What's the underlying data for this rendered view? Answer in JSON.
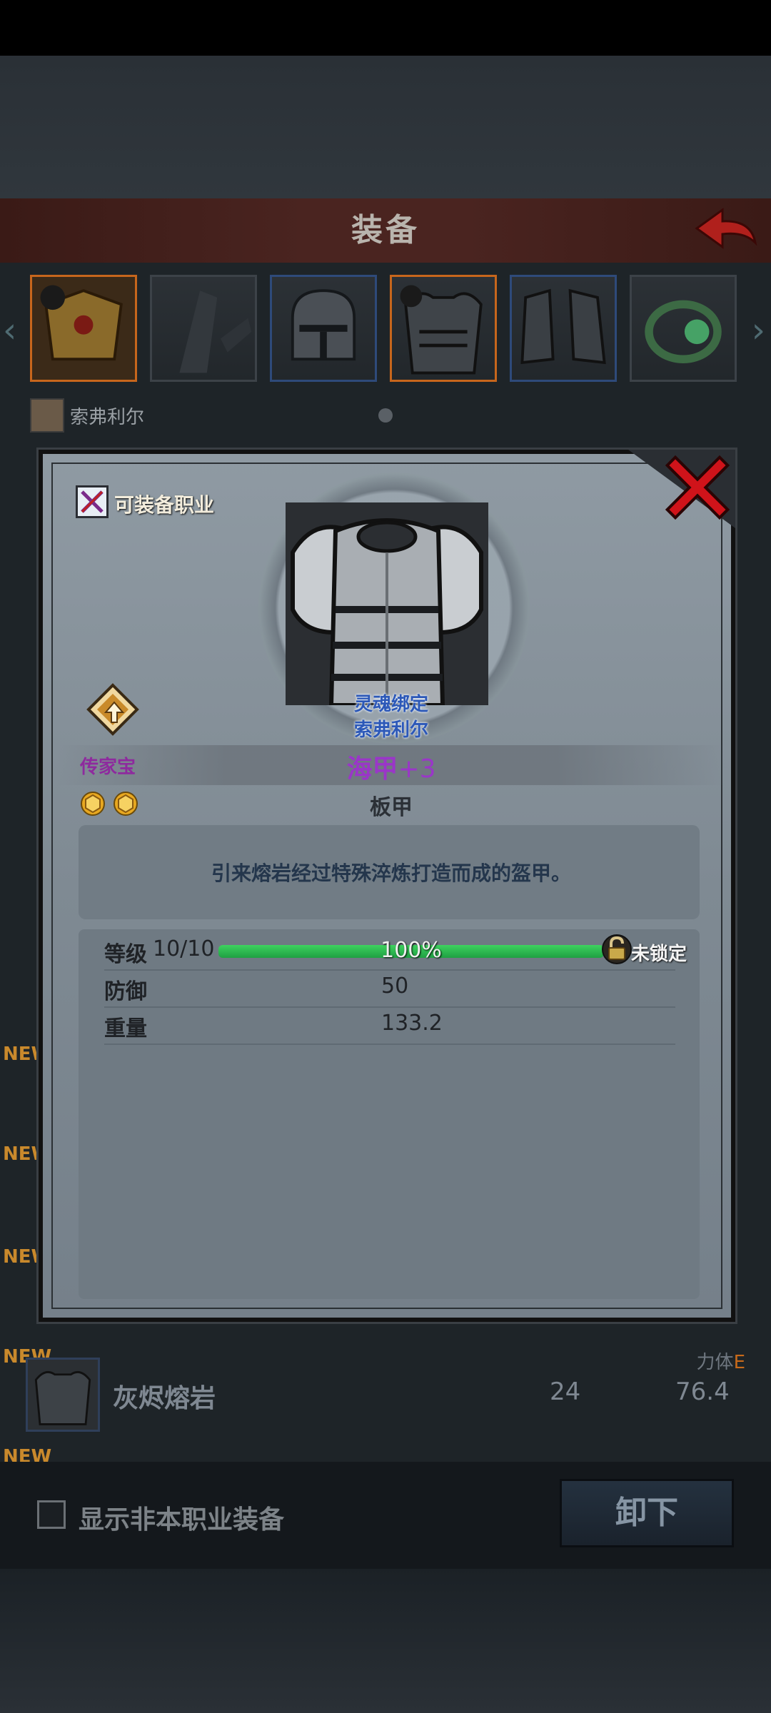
{
  "header": {
    "title": "装备"
  },
  "hero": {
    "name": "索弗利尔"
  },
  "underlying_list": {
    "new_tag": "NEW",
    "visible_item": {
      "name": "灰烬熔岩",
      "stat_1": "24",
      "stat_2": "76.4"
    },
    "stat_header": "力体",
    "stat_grade": "E"
  },
  "footer": {
    "checkbox_label": "显示非本职业装备",
    "unequip_button": "卸下"
  },
  "modal": {
    "class_label": "可装备职业",
    "soulbound_line1": "灵魂绑定",
    "soulbound_line2": "索弗利尔",
    "rarity_label": "传家宝",
    "item_name": "海甲",
    "item_plus": "+3",
    "item_type": "板甲",
    "description": "引来熔岩经过特殊淬炼打造而成的盔甲。",
    "stats": {
      "level_label": "等级",
      "level_value": "10/10",
      "progress_text": "100%",
      "progress_fraction": 1.0,
      "lock_label": "未锁定",
      "defense_label": "防御",
      "defense_value": "50",
      "weight_label": "重量",
      "weight_value": "133.2"
    }
  },
  "colors": {
    "header_bg": "#4a2420",
    "rarity": "#8e2a9e",
    "item_name": "#9a36c8",
    "progress": "#2fc052",
    "close_x": "#d0131a",
    "grade": "#c86a1a"
  }
}
